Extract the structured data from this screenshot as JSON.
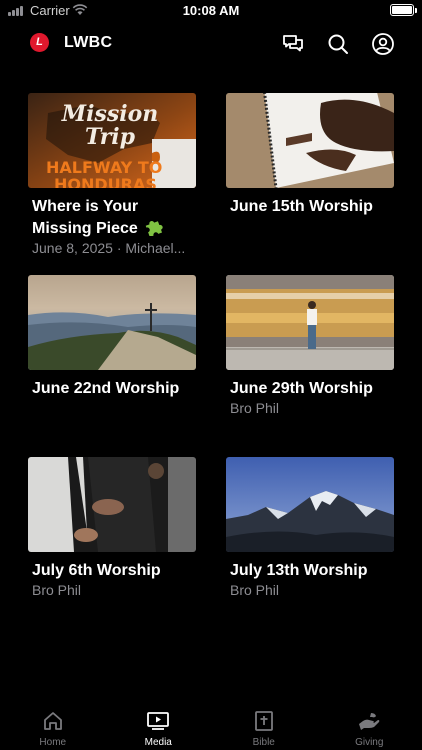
{
  "status_bar": {
    "carrier": "Carrier",
    "time": "10:08 AM"
  },
  "header": {
    "logo_letter": "L",
    "title": "LWBC",
    "icons": [
      "chat-icon",
      "search-icon",
      "profile-icon"
    ]
  },
  "media_items": [
    {
      "title": "Where is Your Missing Piece",
      "subtitle": "June 8, 2025 · Michael...",
      "thumb_text_1": "Mission",
      "thumb_text_2": "Trip",
      "thumb_text_3": "HALFWAY TO",
      "thumb_text_4": "HONDURAS"
    },
    {
      "title": "June 15th Worship",
      "subtitle": ""
    },
    {
      "title": "June 22nd Worship",
      "subtitle": ""
    },
    {
      "title": "June 29th Worship",
      "subtitle": "Bro Phil"
    },
    {
      "title": "July 6th Worship",
      "subtitle": "Bro Phil"
    },
    {
      "title": "July 13th Worship",
      "subtitle": "Bro Phil"
    }
  ],
  "tabs": [
    {
      "label": "Home",
      "icon": "home-icon",
      "active": false
    },
    {
      "label": "Media",
      "icon": "media-icon",
      "active": true
    },
    {
      "label": "Bible",
      "icon": "bible-icon",
      "active": false
    },
    {
      "label": "Giving",
      "icon": "giving-icon",
      "active": false
    }
  ],
  "colors": {
    "background": "#000000",
    "logo_red": "#e0182d",
    "subtitle_gray": "#8d8d92",
    "tab_inactive": "#7a7a7e"
  }
}
